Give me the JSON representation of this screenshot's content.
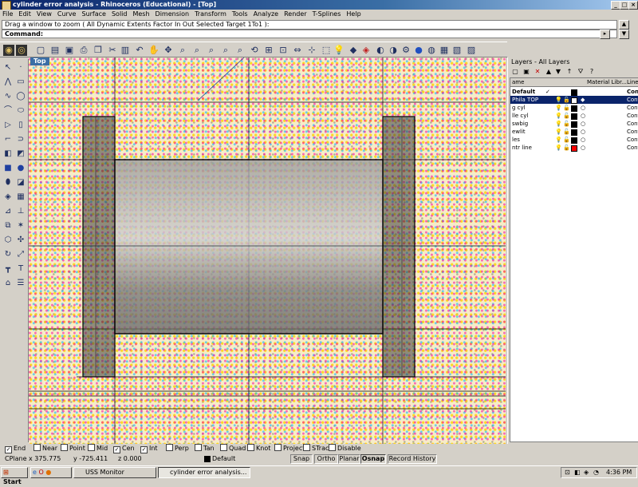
{
  "window": {
    "title": "cylinder error analysis - Rhinoceros (Educational) - [Top]",
    "min": "_",
    "max": "□",
    "close": "×"
  },
  "menu": [
    "File",
    "Edit",
    "View",
    "Curve",
    "Surface",
    "Solid",
    "Mesh",
    "Dimension",
    "Transform",
    "Tools",
    "Analyze",
    "Render",
    "T-Splines",
    "Help"
  ],
  "command": {
    "history": "Drag a window to zoom ( All  Dynamic  Extents  Factor  In  Out  Selected  Target  1To1 ):",
    "prompt": "Command:"
  },
  "viewport": {
    "label": "Top"
  },
  "layers": {
    "title": "Layers - All Layers",
    "columns": {
      "name": "ame",
      "material": "Material Libr...",
      "linetype": "Line"
    },
    "rows": [
      {
        "name": "Default",
        "check": "✓",
        "color": "#000000",
        "linetype": "Con",
        "selected": false
      },
      {
        "name": "Phila TOP",
        "check": "",
        "color": "#ffffff",
        "linetype": "Cont",
        "selected": true
      },
      {
        "name": "g cyl",
        "check": "",
        "color": "#000000",
        "linetype": "Cont",
        "selected": false
      },
      {
        "name": "lle cyl",
        "check": "",
        "color": "#000000",
        "linetype": "Cont",
        "selected": false
      },
      {
        "name": "swbig",
        "check": "",
        "color": "#000000",
        "linetype": "Cont",
        "selected": false
      },
      {
        "name": "ewlit",
        "check": "",
        "color": "#000000",
        "linetype": "Cont",
        "selected": false
      },
      {
        "name": "les",
        "check": "",
        "color": "#000000",
        "linetype": "Cont",
        "selected": false
      },
      {
        "name": "ntr line",
        "check": "",
        "color": "#ff0000",
        "linetype": "Cont",
        "selected": false
      }
    ]
  },
  "osnap": [
    {
      "label": "End",
      "checked": true
    },
    {
      "label": "Near",
      "checked": false
    },
    {
      "label": "Point",
      "checked": false
    },
    {
      "label": "Mid",
      "checked": false
    },
    {
      "label": "Cen",
      "checked": true
    },
    {
      "label": "Int",
      "checked": true
    },
    {
      "label": "Perp",
      "checked": false
    },
    {
      "label": "Tan",
      "checked": false
    },
    {
      "label": "Quad",
      "checked": false
    },
    {
      "label": "Knot",
      "checked": false
    },
    {
      "label": "Project",
      "checked": false
    },
    {
      "label": "STrack",
      "checked": false
    },
    {
      "label": "Disable",
      "checked": false
    }
  ],
  "status": {
    "cplane": "CPlane",
    "x": "x 375.775",
    "y": "y -725.411",
    "z": "z 0.000",
    "layer": "Default",
    "snap": "Snap",
    "ortho": "Ortho",
    "planar": "Planar",
    "osnap": "Osnap",
    "record": "Record History"
  },
  "taskbar": {
    "start": "Start",
    "tasks": [
      "USS Monitor",
      "cylinder error analysis..."
    ],
    "clock": "4:36 PM"
  }
}
